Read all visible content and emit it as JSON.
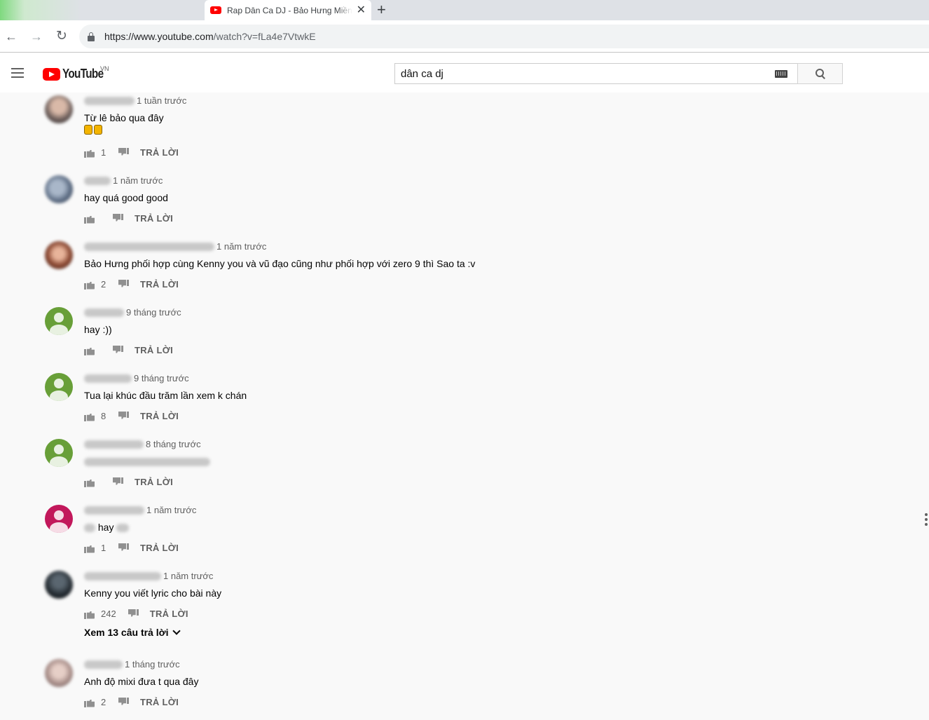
{
  "browser": {
    "tab_title": "Rap Dân Ca DJ - Bảo Hưng Miền Tây",
    "tab_close": "✕",
    "new_tab": "+",
    "url_host": "https://www.youtube.com",
    "url_rest": "/watch?v=fLa4e7VtwkE"
  },
  "masthead": {
    "logo_text": "YouTube",
    "country": "VN",
    "search_value": "dân ca dj"
  },
  "reply_label": "TRẢ LỜI",
  "comments": [
    {
      "time": "1 tuần trước",
      "text": "Từ lê bảo qua đây",
      "likes": "1"
    },
    {
      "time": "1 năm trước",
      "text": "hay quá good good",
      "likes": ""
    },
    {
      "time": "1 năm trước",
      "text": "Bảo Hưng phối hợp cùng Kenny you và vũ đạo cũng như phối hợp với zero 9 thì Sao ta :v",
      "likes": "2"
    },
    {
      "time": "9 tháng trước",
      "text": "hay :))",
      "likes": ""
    },
    {
      "time": "9 tháng trước",
      "text": "Tua lại khúc đầu trăm lần xem k chán",
      "likes": "8"
    },
    {
      "time": "8 tháng trước",
      "text": "",
      "likes": ""
    },
    {
      "time": "1 năm trước",
      "text": "hay",
      "likes": "1"
    },
    {
      "time": "1 năm trước",
      "text": "Kenny you viết lyric cho bài này",
      "likes": "242",
      "view_replies": "Xem 13 câu trả lời"
    },
    {
      "time": "1 tháng trước",
      "text": "Anh độ mixi đưa t qua đây",
      "likes": "2"
    }
  ]
}
